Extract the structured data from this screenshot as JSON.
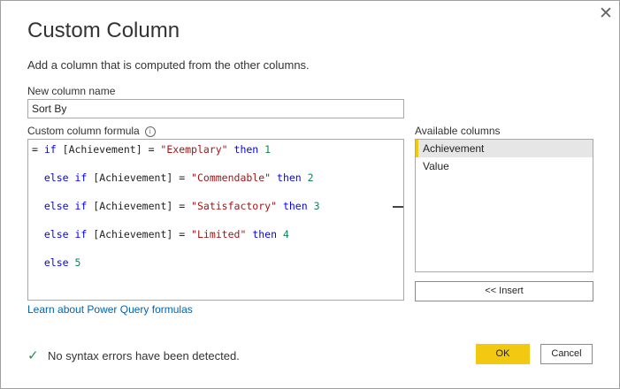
{
  "dialog": {
    "title": "Custom Column",
    "subtitle": "Add a column that is computed from the other columns.",
    "close_symbol": "✕"
  },
  "new_column": {
    "label": "New column name",
    "value": "Sort By"
  },
  "formula": {
    "label": "Custom column formula",
    "info_symbol": "i",
    "lines": [
      [
        {
          "t": "= ",
          "c": "p"
        },
        {
          "t": "if",
          "c": "kw"
        },
        {
          "t": " [Achievement] = ",
          "c": "p"
        },
        {
          "t": "\"Exemplary\"",
          "c": "str"
        },
        {
          "t": " ",
          "c": "p"
        },
        {
          "t": "then",
          "c": "kw"
        },
        {
          "t": " ",
          "c": "p"
        },
        {
          "t": "1",
          "c": "num"
        }
      ],
      [
        {
          "t": "  ",
          "c": "p"
        },
        {
          "t": "else",
          "c": "kw"
        },
        {
          "t": " ",
          "c": "p"
        },
        {
          "t": "if",
          "c": "kw"
        },
        {
          "t": " [Achievement] = ",
          "c": "p"
        },
        {
          "t": "\"Commendable\"",
          "c": "str"
        },
        {
          "t": " ",
          "c": "p"
        },
        {
          "t": "then",
          "c": "kw"
        },
        {
          "t": " ",
          "c": "p"
        },
        {
          "t": "2",
          "c": "num"
        }
      ],
      [
        {
          "t": "  ",
          "c": "p"
        },
        {
          "t": "else",
          "c": "kw"
        },
        {
          "t": " ",
          "c": "p"
        },
        {
          "t": "if",
          "c": "kw"
        },
        {
          "t": " [Achievement] = ",
          "c": "p"
        },
        {
          "t": "\"Satisfactory\"",
          "c": "str"
        },
        {
          "t": " ",
          "c": "p"
        },
        {
          "t": "then",
          "c": "kw"
        },
        {
          "t": " ",
          "c": "p"
        },
        {
          "t": "3",
          "c": "num"
        }
      ],
      [
        {
          "t": "  ",
          "c": "p"
        },
        {
          "t": "else",
          "c": "kw"
        },
        {
          "t": " ",
          "c": "p"
        },
        {
          "t": "if",
          "c": "kw"
        },
        {
          "t": " [Achievement] = ",
          "c": "p"
        },
        {
          "t": "\"Limited\"",
          "c": "str"
        },
        {
          "t": " ",
          "c": "p"
        },
        {
          "t": "then",
          "c": "kw"
        },
        {
          "t": " ",
          "c": "p"
        },
        {
          "t": "4",
          "c": "num"
        }
      ],
      [
        {
          "t": "  ",
          "c": "p"
        },
        {
          "t": "else",
          "c": "kw"
        },
        {
          "t": " ",
          "c": "p"
        },
        {
          "t": "5",
          "c": "num"
        }
      ]
    ]
  },
  "available_columns": {
    "label": "Available columns",
    "items": [
      "Achievement",
      "Value"
    ],
    "selected_index": 0,
    "insert_label": "<< Insert"
  },
  "learn_link": "Learn about Power Query formulas",
  "status": {
    "icon": "check-icon",
    "symbol": "✓",
    "text": "No syntax errors have been detected."
  },
  "buttons": {
    "ok": "OK",
    "cancel": "Cancel"
  },
  "colors": {
    "accent": "#f2c811",
    "keyword": "#0000ff",
    "string": "#a31515",
    "number": "#098658",
    "link": "#0063b1",
    "success": "#2e8b57"
  }
}
